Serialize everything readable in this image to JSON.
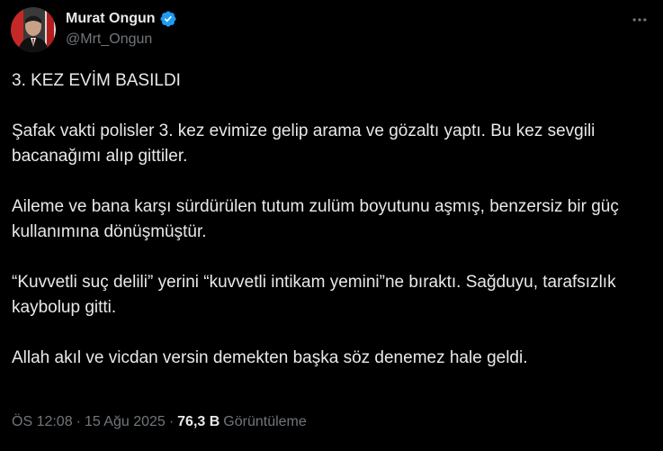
{
  "author": {
    "display_name": "Murat Ongun",
    "handle": "@Mrt_Ongun",
    "verified_color": "#1d9bf0"
  },
  "tweet": {
    "paragraphs": [
      "3. KEZ EVİM BASILDI",
      "Şafak vakti polisler 3. kez evimize gelip arama ve gözaltı yaptı. Bu kez sevgili bacanağımı alıp gittiler.",
      "Aileme ve bana karşı sürdürülen tutum zulüm boyutunu aşmış, benzersiz bir güç kullanımına dönüşmüştür.",
      "“Kuvvetli suç delili” yerini “kuvvetli intikam yemini”ne bıraktı. Sağduyu, tarafsızlık kaybolup gitti.",
      "Allah akıl ve vicdan versin demekten başka söz denemez hale geldi."
    ]
  },
  "meta": {
    "time": "ÖS 12:08",
    "separator": "·",
    "date": "15 Ağu 2025",
    "views_count": "76,3 B",
    "views_label": "Görüntüleme"
  },
  "icons": {
    "more": "more-options-icon",
    "verified": "verified-badge-icon",
    "avatar": "profile-avatar"
  },
  "colors": {
    "background": "#000000",
    "text": "#e7e9ea",
    "secondary": "#71767b",
    "accent": "#1d9bf0"
  }
}
